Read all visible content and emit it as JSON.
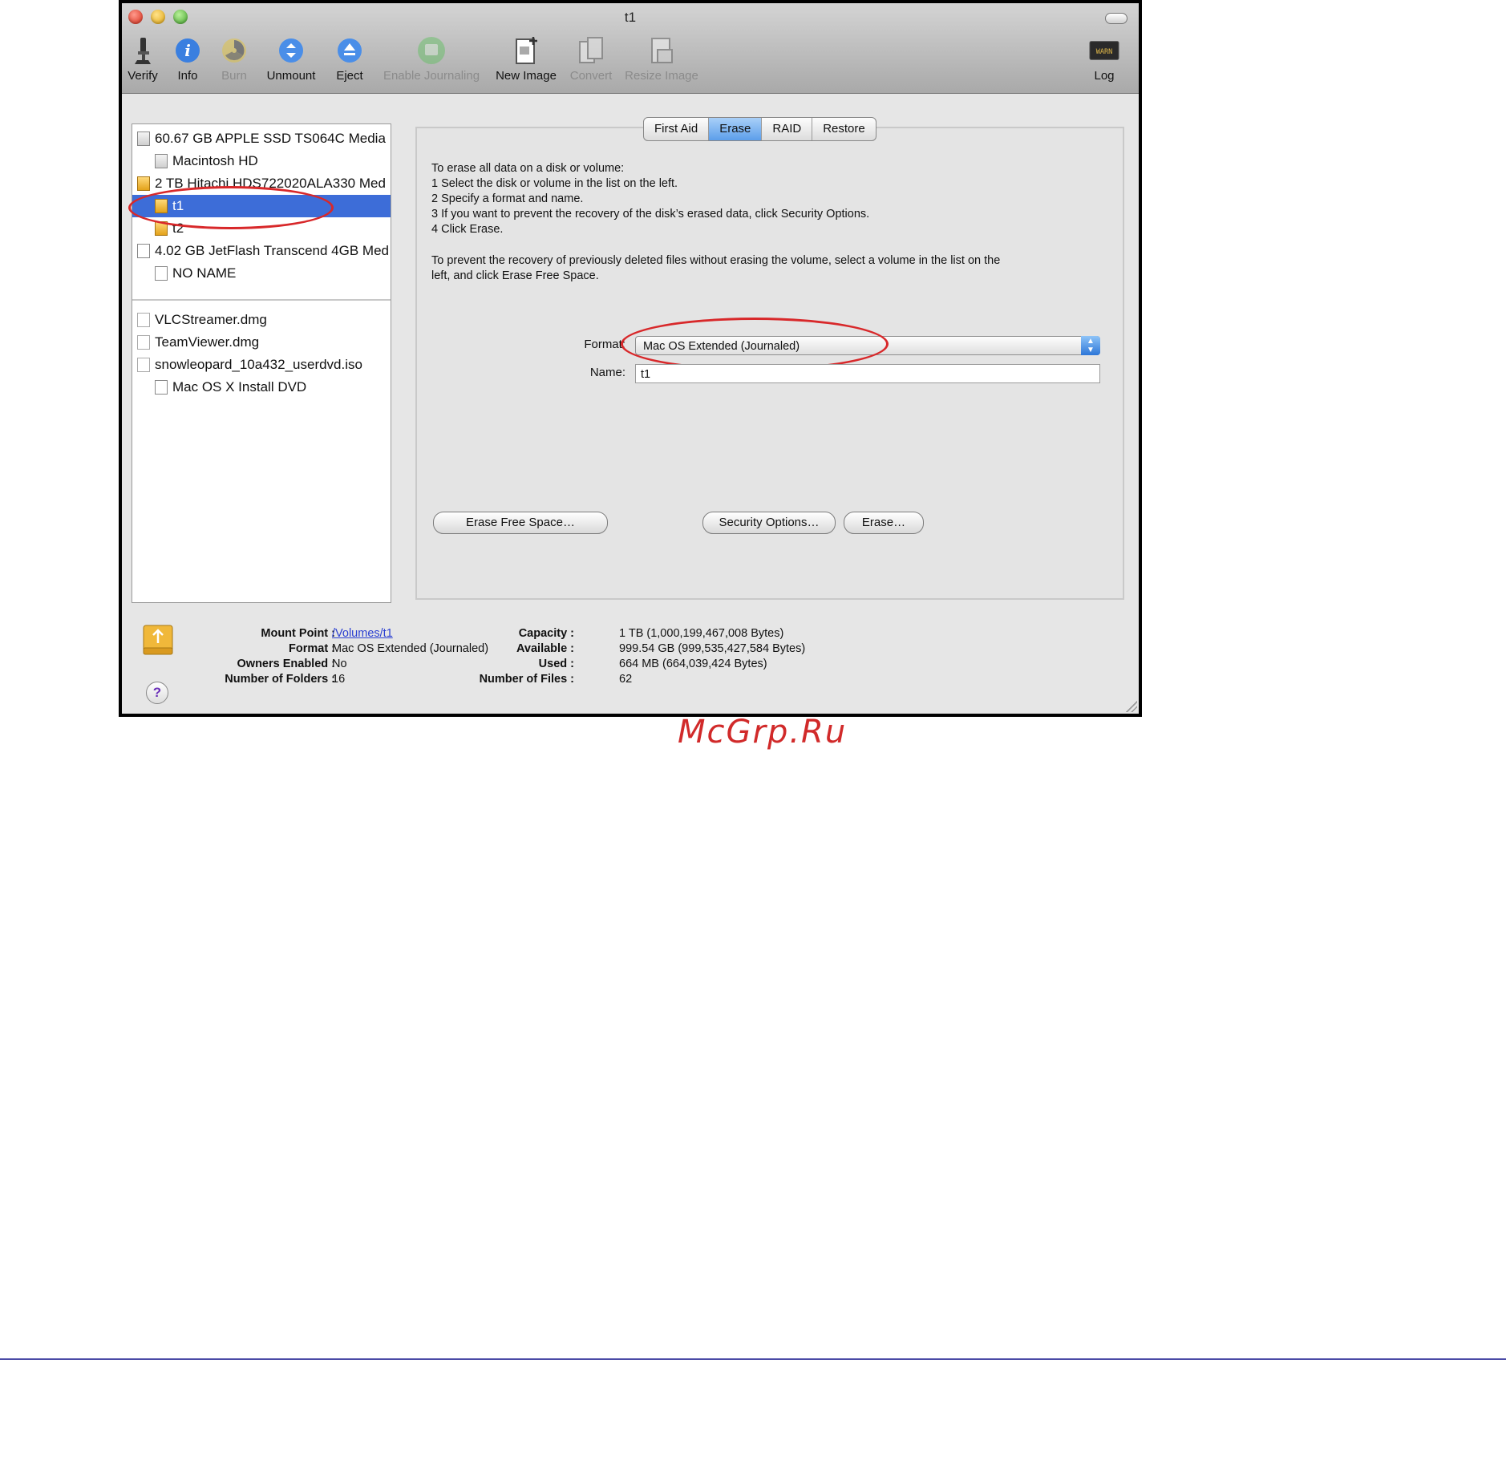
{
  "window": {
    "title": "t1"
  },
  "toolbar": {
    "verify": "Verify",
    "info": "Info",
    "burn": "Burn",
    "unmount": "Unmount",
    "eject": "Eject",
    "enable_journaling": "Enable Journaling",
    "new_image": "New Image",
    "convert": "Convert",
    "resize_image": "Resize Image",
    "log": "Log"
  },
  "sidebar": {
    "disks": [
      "60.67 GB APPLE SSD TS064C Media",
      "Macintosh HD",
      "2 TB Hitachi HDS722020ALA330 Med",
      "t1",
      "t2",
      "4.02 GB JetFlash Transcend 4GB Med",
      "NO NAME"
    ],
    "images": [
      "VLCStreamer.dmg",
      "TeamViewer.dmg",
      "snowleopard_10a432_userdvd.iso",
      "Mac OS X Install DVD"
    ]
  },
  "tabs": [
    "First Aid",
    "Erase",
    "RAID",
    "Restore"
  ],
  "instructions": {
    "line1": "To erase all data on a disk or volume:",
    "line2": "1  Select the disk or volume in the list on the left.",
    "line3": "2  Specify a format and name.",
    "line4": "3  If you want to prevent the recovery of the disk’s erased data, click Security Options.",
    "line5": "4  Click Erase.",
    "line6": "To prevent the recovery of previously deleted files without erasing the volume, select a volume in the list on the",
    "line7": "left, and click Erase Free Space."
  },
  "form": {
    "format_label": "Format:",
    "format_value": "Mac OS Extended (Journaled)",
    "name_label": "Name:",
    "name_value": "t1"
  },
  "buttons": {
    "erase_free_space": "Erase Free Space…",
    "security_options": "Security Options…",
    "erase": "Erase…"
  },
  "info": {
    "mount_point_label": "Mount Point :",
    "mount_point_value": "/Volumes/t1",
    "format_label": "Format :",
    "format_value": "Mac OS Extended (Journaled)",
    "owners_label": "Owners Enabled :",
    "owners_value": "No",
    "folders_label": "Number of Folders :",
    "folders_value": "16",
    "capacity_label": "Capacity :",
    "capacity_value": "1 TB (1,000,199,467,008 Bytes)",
    "available_label": "Available :",
    "available_value": "999.54 GB (999,535,427,584 Bytes)",
    "used_label": "Used :",
    "used_value": "664 MB (664,039,424 Bytes)",
    "files_label": "Number of Files :",
    "files_value": "62",
    "help": "?"
  },
  "watermark": "McGrp.Ru",
  "colors": {
    "selection": "#3d6dd8",
    "annotation": "#d8282a",
    "active_tab": "#5c9eea"
  }
}
